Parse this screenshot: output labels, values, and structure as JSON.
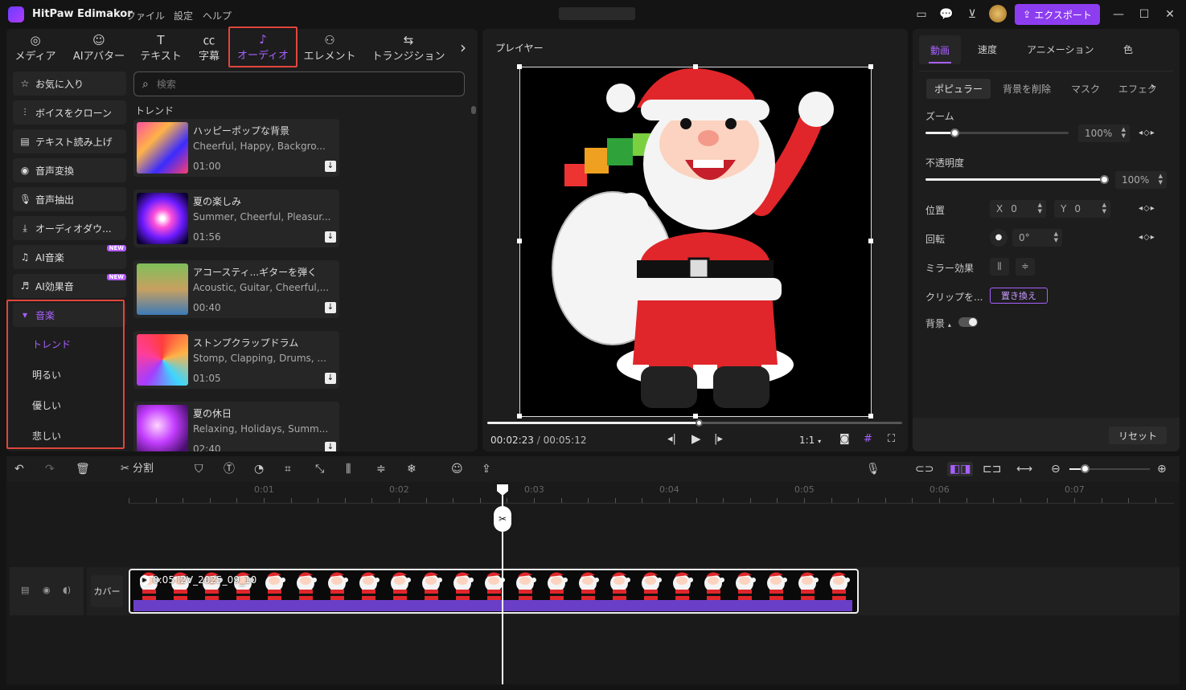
{
  "app": {
    "name": "HitPaw Edimakor"
  },
  "menu": [
    "ファイル",
    "設定",
    "ヘルプ"
  ],
  "export_label": "エクスポート",
  "tabs": [
    {
      "icon": "media-icon",
      "label": "メディア"
    },
    {
      "icon": "ai-avatar-icon",
      "label": "AIアバター"
    },
    {
      "icon": "text-icon",
      "label": "テキスト"
    },
    {
      "icon": "subtitle-icon",
      "label": "字幕"
    },
    {
      "icon": "audio-icon",
      "label": "オーディオ"
    },
    {
      "icon": "element-icon",
      "label": "エレメント"
    },
    {
      "icon": "transition-icon",
      "label": "トランジション"
    }
  ],
  "sidebar": {
    "items": [
      {
        "icon": "star-icon",
        "label": "お気に入り"
      },
      {
        "icon": "voice-clone-icon",
        "label": "ボイスをクローン"
      },
      {
        "icon": "tts-icon",
        "label": "テキスト読み上げ"
      },
      {
        "icon": "voice-change-icon",
        "label": "音声変換"
      },
      {
        "icon": "mic-icon",
        "label": "音声抽出"
      },
      {
        "icon": "audio-download-icon",
        "label": "オーディオダウ..."
      },
      {
        "icon": "ai-music-icon",
        "label": "AI音楽",
        "badge": "NEW"
      },
      {
        "icon": "ai-sfx-icon",
        "label": "AI効果音",
        "badge": "NEW"
      }
    ],
    "music": {
      "label": "音楽",
      "subs": [
        "トレンド",
        "明るい",
        "優しい",
        "悲しい"
      ]
    }
  },
  "search": {
    "placeholder": "検索"
  },
  "trend_label": "トレンド",
  "tracks": [
    {
      "title": "ハッピーポップな背景",
      "tags": "Cheerful, Happy, Backgro...",
      "duration": "01:00"
    },
    {
      "title": "夏の楽しみ",
      "tags": "Summer, Cheerful, Pleasur...",
      "duration": "01:56"
    },
    {
      "title": "アコースティ...ギターを弾く",
      "tags": "Acoustic, Guitar, Cheerful,...",
      "duration": "00:40"
    },
    {
      "title": "ストンプクラップドラム",
      "tags": "Stomp, Clapping, Drums, ...",
      "duration": "01:05"
    },
    {
      "title": "夏の休日",
      "tags": "Relaxing, Holidays, Summ...",
      "duration": "02:40"
    }
  ],
  "player": {
    "title": "プレイヤー",
    "current": "00:02:23",
    "total": "00:05:12",
    "ratio": "1:1",
    "progress": 0.51
  },
  "right": {
    "tabs": [
      "動画",
      "速度",
      "アニメーション",
      "色"
    ],
    "subtabs": [
      "ポピュラー",
      "背景を削除",
      "マスク",
      "エフェク"
    ],
    "zoom_label": "ズーム",
    "zoom_value": "100%",
    "zoom_level": 0.2,
    "opacity_label": "不透明度",
    "opacity_value": "100%",
    "opacity_level": 1.0,
    "position_label": "位置",
    "x_label": "X",
    "x_value": "0",
    "y_label": "Y",
    "y_value": "0",
    "rotation_label": "回転",
    "rotation_value": "0°",
    "mirror_label": "ミラー効果",
    "clip_label": "クリップを...",
    "replace_label": "置き換え",
    "bg_label": "背景",
    "reset_label": "リセット"
  },
  "toolbar": {
    "split_label": "分割"
  },
  "ruler": [
    "0:01",
    "0:02",
    "0:03",
    "0:04",
    "0:05",
    "0:06",
    "0:07"
  ],
  "track": {
    "cover_label": "カバー",
    "clip_label": "0:05  I2V_2025_09_10"
  }
}
